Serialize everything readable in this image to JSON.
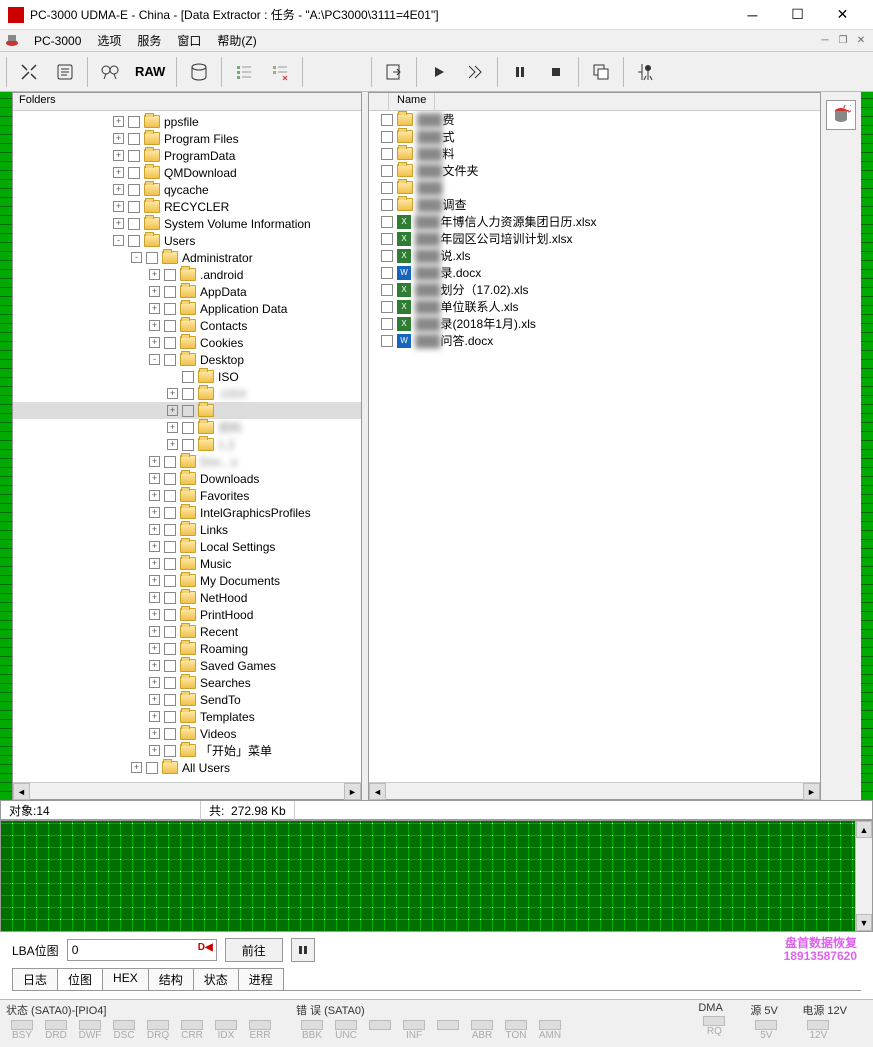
{
  "window": {
    "title": "PC-3000 UDMA-E - China - [Data Extractor : 任务 - \"A:\\PC3000\\3111=4E01\"]"
  },
  "menu": {
    "pc3000": "PC-3000",
    "options": "选项",
    "service": "服务",
    "window": "窗口",
    "help": "帮助(Z)"
  },
  "toolbar": {
    "raw": "RAW"
  },
  "folders_header": "Folders",
  "name_header": "Name",
  "tree": [
    {
      "indent": 0,
      "toggle": "+",
      "label": "ppsfile"
    },
    {
      "indent": 0,
      "toggle": "+",
      "label": "Program Files"
    },
    {
      "indent": 0,
      "toggle": "+",
      "label": "ProgramData"
    },
    {
      "indent": 0,
      "toggle": "+",
      "label": "QMDownload"
    },
    {
      "indent": 0,
      "toggle": "+",
      "label": "qycache"
    },
    {
      "indent": 0,
      "toggle": "+",
      "label": "RECYCLER"
    },
    {
      "indent": 0,
      "toggle": "+",
      "label": "System Volume Information"
    },
    {
      "indent": 0,
      "toggle": "-",
      "label": "Users"
    },
    {
      "indent": 1,
      "toggle": "-",
      "label": "Administrator"
    },
    {
      "indent": 2,
      "toggle": "+",
      "label": ".android"
    },
    {
      "indent": 2,
      "toggle": "+",
      "label": "AppData"
    },
    {
      "indent": 2,
      "toggle": "+",
      "label": "Application Data"
    },
    {
      "indent": 2,
      "toggle": "+",
      "label": "Contacts"
    },
    {
      "indent": 2,
      "toggle": "+",
      "label": "Cookies"
    },
    {
      "indent": 2,
      "toggle": "-",
      "label": "Desktop"
    },
    {
      "indent": 3,
      "toggle": " ",
      "label": "ISO"
    },
    {
      "indent": 3,
      "toggle": "+",
      "label": ".OSX",
      "blur": true
    },
    {
      "indent": 3,
      "toggle": "+",
      "label": "",
      "selected": true,
      "blur": true
    },
    {
      "indent": 3,
      "toggle": "+",
      "label": "资料",
      "blur": true
    },
    {
      "indent": 3,
      "toggle": "+",
      "label": "1.2",
      "blur": true
    },
    {
      "indent": 2,
      "toggle": "+",
      "label": "Doc...s",
      "blur": true
    },
    {
      "indent": 2,
      "toggle": "+",
      "label": "Downloads"
    },
    {
      "indent": 2,
      "toggle": "+",
      "label": "Favorites"
    },
    {
      "indent": 2,
      "toggle": "+",
      "label": "IntelGraphicsProfiles"
    },
    {
      "indent": 2,
      "toggle": "+",
      "label": "Links"
    },
    {
      "indent": 2,
      "toggle": "+",
      "label": "Local Settings"
    },
    {
      "indent": 2,
      "toggle": "+",
      "label": "Music"
    },
    {
      "indent": 2,
      "toggle": "+",
      "label": "My Documents"
    },
    {
      "indent": 2,
      "toggle": "+",
      "label": "NetHood"
    },
    {
      "indent": 2,
      "toggle": "+",
      "label": "PrintHood"
    },
    {
      "indent": 2,
      "toggle": "+",
      "label": "Recent"
    },
    {
      "indent": 2,
      "toggle": "+",
      "label": "Roaming"
    },
    {
      "indent": 2,
      "toggle": "+",
      "label": "Saved Games"
    },
    {
      "indent": 2,
      "toggle": "+",
      "label": "Searches"
    },
    {
      "indent": 2,
      "toggle": "+",
      "label": "SendTo"
    },
    {
      "indent": 2,
      "toggle": "+",
      "label": "Templates"
    },
    {
      "indent": 2,
      "toggle": "+",
      "label": "Videos"
    },
    {
      "indent": 2,
      "toggle": "+",
      "label": "「开始」菜单"
    },
    {
      "indent": 1,
      "toggle": "+",
      "label": "All Users"
    }
  ],
  "files": [
    {
      "type": "folder",
      "label": "费",
      "blur": true
    },
    {
      "type": "folder",
      "label": "式",
      "blur": true
    },
    {
      "type": "folder",
      "label": "料",
      "blur": true
    },
    {
      "type": "folder",
      "label": "文件夹",
      "blur": true
    },
    {
      "type": "folder",
      "label": "",
      "blur": true
    },
    {
      "type": "folder",
      "label": "调查",
      "blur": true
    },
    {
      "type": "xls",
      "label": "年博信人力资源集团日历.xlsx",
      "blur": true
    },
    {
      "type": "xls",
      "label": "年园区公司培训计划.xlsx",
      "blur": true
    },
    {
      "type": "xls",
      "label": "说.xls",
      "blur": true
    },
    {
      "type": "doc",
      "label": "录.docx",
      "blur": true
    },
    {
      "type": "xls",
      "label": "划分（17.02).xls",
      "blur": true
    },
    {
      "type": "xls",
      "label": "单位联系人.xls",
      "blur": true
    },
    {
      "type": "xls",
      "label": "录(2018年1月).xls",
      "blur": true
    },
    {
      "type": "doc",
      "label": "问答.docx",
      "blur": true
    }
  ],
  "status": {
    "objects_label": "对象:",
    "objects_val": "14",
    "total_label": "共:",
    "total_val": "272.98 Kb"
  },
  "lba": {
    "label": "LBA位图",
    "value": "0",
    "go": "前往",
    "pindicator": "D◀"
  },
  "watermark": {
    "line1": "盘首数据恢复",
    "line2": "18913587620"
  },
  "tabs": {
    "log": "日志",
    "bitmap": "位图",
    "hex": "HEX",
    "struct": "结构",
    "status": "状态",
    "progress": "进程"
  },
  "bottom": {
    "status_title": "状态 (SATA0)-[PIO4]",
    "status_items": [
      "BSY",
      "DRD",
      "DWF",
      "DSC",
      "DRQ",
      "CRR",
      "IDX",
      "ERR"
    ],
    "error_title": "错 误 (SATA0)",
    "error_items": [
      "BBK",
      "UNC",
      "",
      "INF",
      "",
      "ABR",
      "TON",
      "AMN"
    ],
    "dma_title": "DMA",
    "dma_items": [
      "RQ"
    ],
    "src5v_title": "源 5V",
    "src5v_items": [
      "5V"
    ],
    "pwr12v_title": "电源 12V",
    "pwr12v_items": [
      "12V"
    ]
  }
}
